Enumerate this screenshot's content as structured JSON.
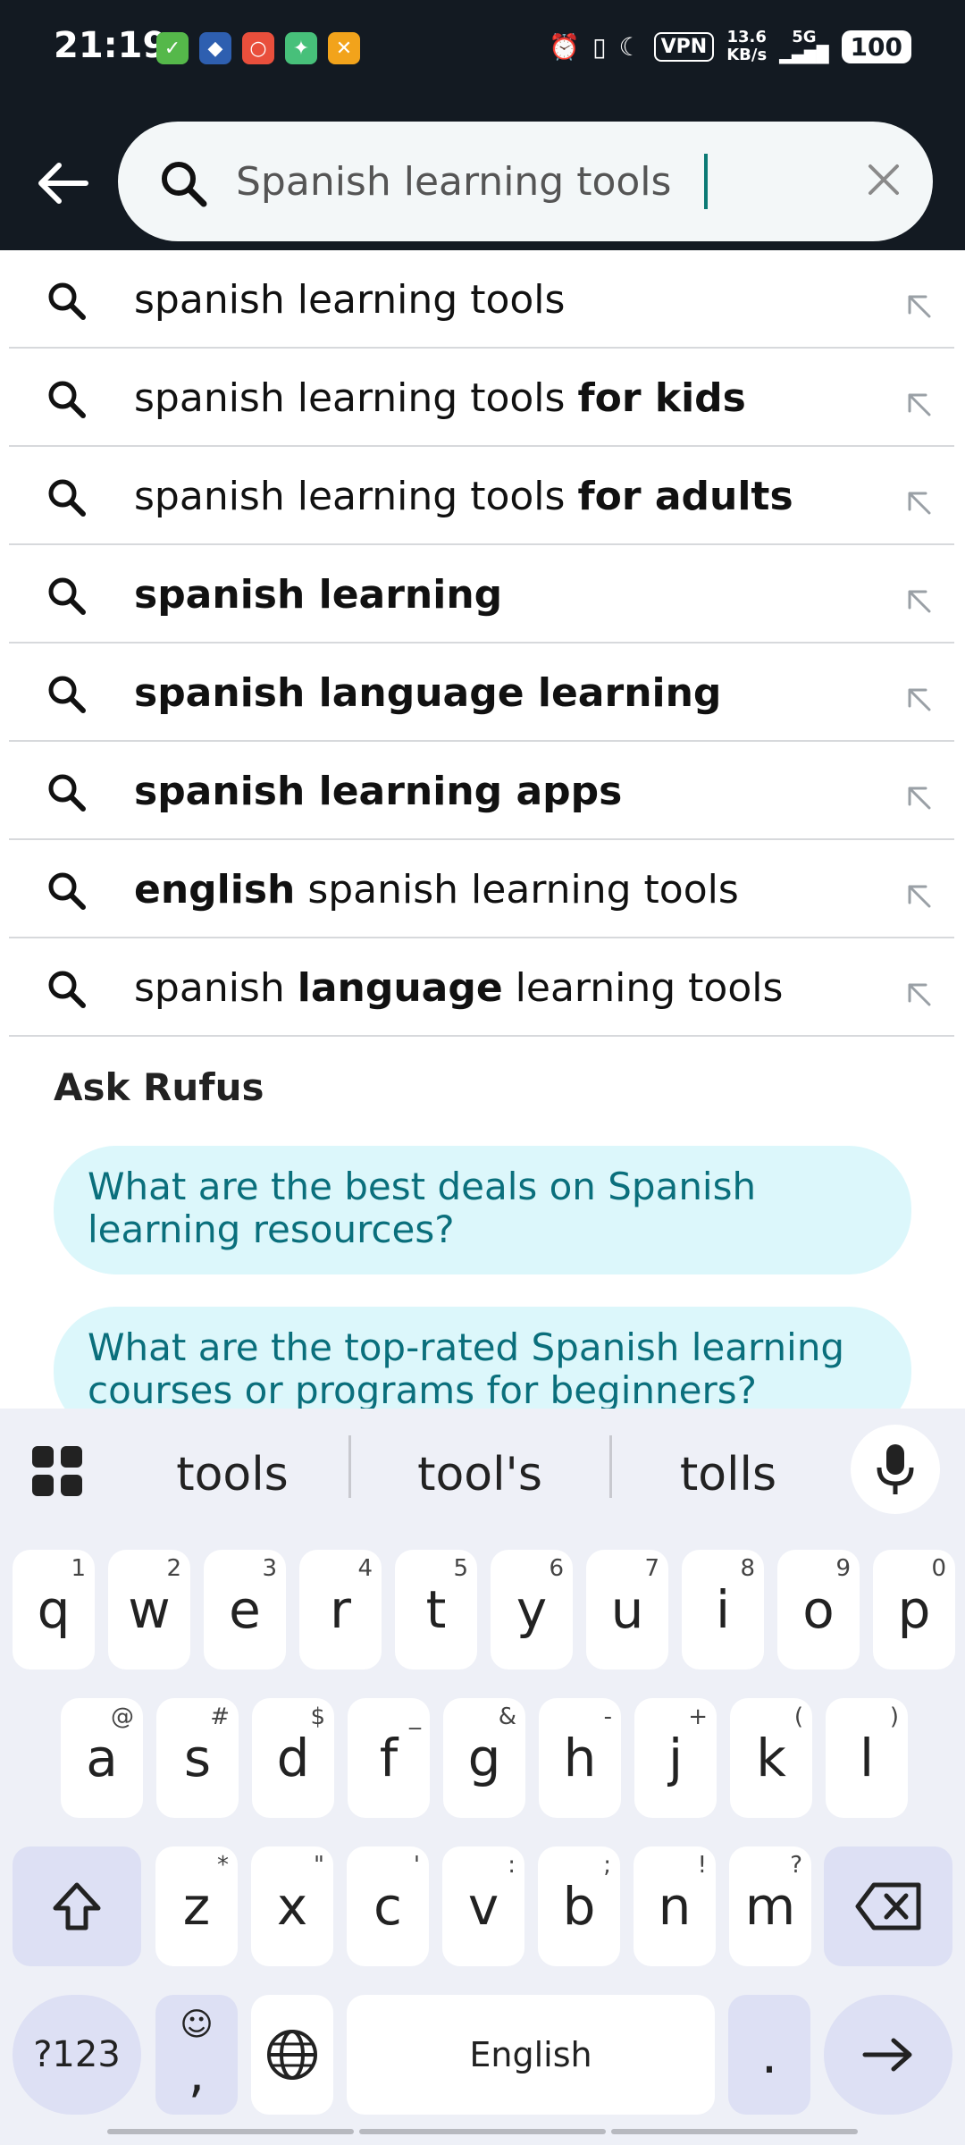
{
  "status_bar": {
    "time": "21:19",
    "vpn": "VPN",
    "speed_top": "13.6",
    "speed_bottom": "KB/s",
    "network": "5G",
    "battery": "100"
  },
  "search": {
    "value": "Spanish learning tools"
  },
  "suggestions": [
    {
      "pre": "spanish learning tools",
      "bold": "",
      "post": ""
    },
    {
      "pre": "spanish learning tools ",
      "bold": "for kids",
      "post": ""
    },
    {
      "pre": "spanish learning tools ",
      "bold": "for adults",
      "post": ""
    },
    {
      "pre": "",
      "bold": "spanish learning",
      "post": ""
    },
    {
      "pre": "",
      "bold": "spanish language learning",
      "post": ""
    },
    {
      "pre": "",
      "bold": "spanish learning apps",
      "post": ""
    },
    {
      "pre": "",
      "bold": "english",
      "post": " spanish learning tools"
    },
    {
      "pre": "spanish ",
      "bold": "language",
      "post": " learning tools"
    }
  ],
  "rufus": {
    "title": "Ask Rufus",
    "questions": [
      "What are the best deals on Spanish learning resources?",
      "What are the top-rated Spanish learning courses or programs for beginners?"
    ]
  },
  "keyboard": {
    "suggestions": [
      "tools",
      "tool's",
      "tolls"
    ],
    "row1": [
      [
        "q",
        "1"
      ],
      [
        "w",
        "2"
      ],
      [
        "e",
        "3"
      ],
      [
        "r",
        "4"
      ],
      [
        "t",
        "5"
      ],
      [
        "y",
        "6"
      ],
      [
        "u",
        "7"
      ],
      [
        "i",
        "8"
      ],
      [
        "o",
        "9"
      ],
      [
        "p",
        "0"
      ]
    ],
    "row2": [
      [
        "a",
        "@"
      ],
      [
        "s",
        "#"
      ],
      [
        "d",
        "$"
      ],
      [
        "f",
        "_"
      ],
      [
        "g",
        "&"
      ],
      [
        "h",
        "-"
      ],
      [
        "j",
        "+"
      ],
      [
        "k",
        "("
      ],
      [
        "l",
        ")"
      ]
    ],
    "row3": [
      [
        "z",
        "*"
      ],
      [
        "x",
        "\""
      ],
      [
        "c",
        "'"
      ],
      [
        "v",
        ":"
      ],
      [
        "b",
        ";"
      ],
      [
        "n",
        "!"
      ],
      [
        "m",
        "?"
      ]
    ],
    "symbols_label": "?123",
    "comma_label": ",",
    "space_label": "English",
    "period_label": "."
  }
}
